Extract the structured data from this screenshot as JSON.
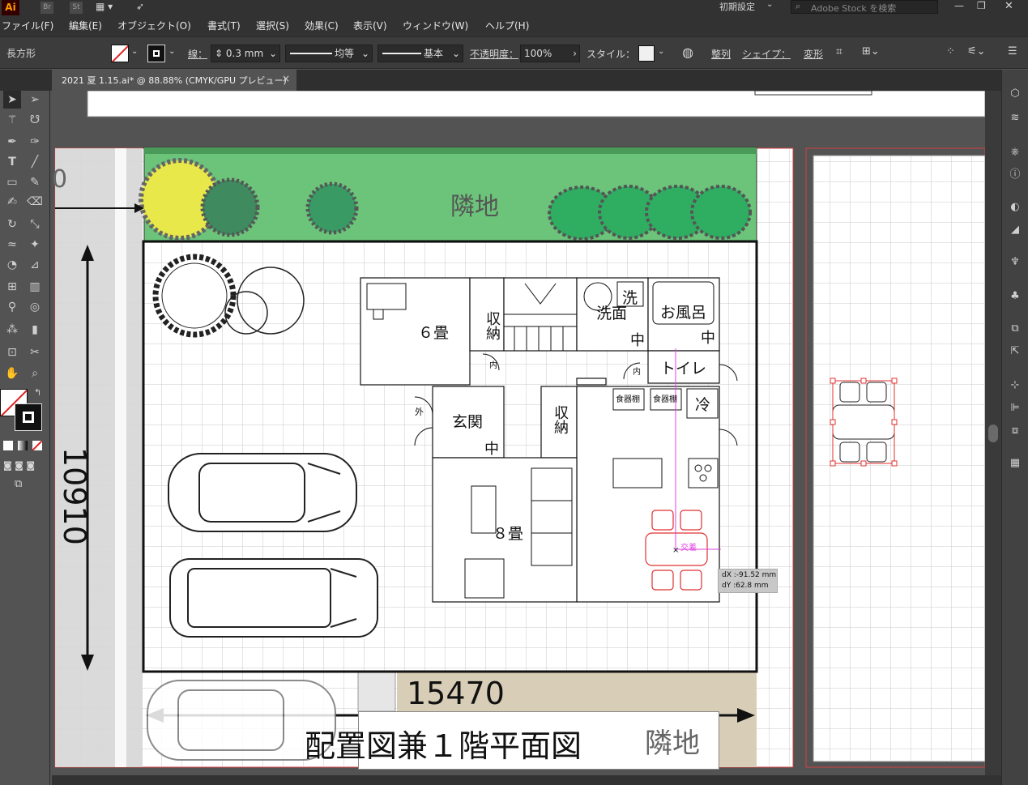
{
  "app": {
    "logo": "Ai",
    "bridge": "Br",
    "stock": "St",
    "workspace": "初期設定",
    "search_placeholder": "Adobe Stock を検索"
  },
  "menu": [
    "ファイル(F)",
    "編集(E)",
    "オブジェクト(O)",
    "書式(T)",
    "選択(S)",
    "効果(C)",
    "表示(V)",
    "ウィンドウ(W)",
    "ヘルプ(H)"
  ],
  "control": {
    "shape": "長方形",
    "stroke_label": "線：",
    "stroke_weight": "0.3 mm",
    "stroke_profile": "均等",
    "brush": "基本",
    "opacity_label": "不透明度：",
    "opacity": "100%",
    "style_label": "スタイル：",
    "align": "整列",
    "shape_menu": "シェイプ：",
    "transform": "変形"
  },
  "doc_tab": {
    "title": "2021 夏 1.15.ai* @ 88.88% (CMYK/GPU プレビュー)",
    "close": "×"
  },
  "drawing": {
    "neighbor_top": "隣地",
    "neighbor_bottom": "隣地",
    "partial_dim": "0",
    "height_dim": "10910",
    "width_dim": "15470",
    "title": "配置図兼１階平面図",
    "rooms": {
      "tatami6": "６畳",
      "storage1": "収納",
      "storage2": "収納",
      "washroom": "洗面",
      "wash": "洗",
      "bath": "お風呂",
      "naka1": "中",
      "naka2": "中",
      "naka3": "中",
      "toilet": "トイレ",
      "uchi1": "内",
      "uchi2": "内",
      "soto": "外",
      "entrance": "玄関",
      "cupboard1": "食器棚",
      "cupboard2": "食器棚",
      "fridge": "冷",
      "tatami8": "８畳"
    },
    "smart_guide": "交差",
    "dx": "dX :-91.52 mm",
    "dy": "dY :62.8 mm"
  },
  "colors": {
    "ui_dark": "#323232",
    "canvas": "#535353",
    "green": "#6cc47a",
    "artboard_border": "#d04040",
    "selection_red": "#e03030",
    "guide_magenta": "#e040e0"
  }
}
